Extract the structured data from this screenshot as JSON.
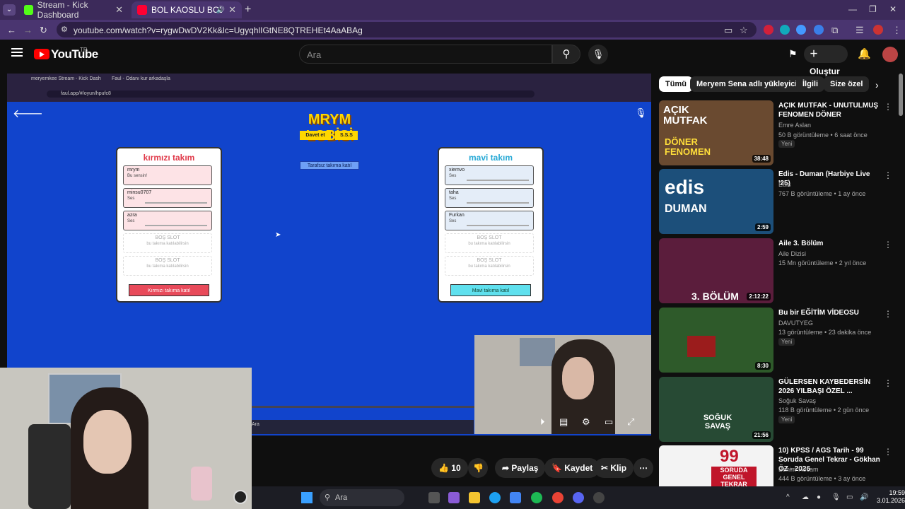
{
  "browser": {
    "tabs": [
      {
        "title": "Stream - Kick Dashboard",
        "favicon_color": "#53fc18"
      },
      {
        "title": "BOL KAOSLU BOL KAVGALI",
        "favicon_color": "#ff0033"
      }
    ],
    "url": "youtube.com/watch?v=rygwDwDV2Kk&lc=UgyqhlIGtNE8QTREHEt4AaABAg"
  },
  "youtube": {
    "logo_text": "YouTube",
    "logo_region": "TR",
    "search_placeholder": "Ara",
    "create_label": "Oluştur"
  },
  "game": {
    "inner_tabs": [
      "meryemkee Stream - Kick Dash",
      "Faul - Odanı kur arkadaşla"
    ],
    "inner_url": "faul.app/#/oyun/hpufc8",
    "lobby_title": "MRYM LOBİSİ",
    "invite_label": "Davet et",
    "faq_label": "S.S.S",
    "neutral_join_label": "Tarafsız takıma katıl",
    "red_team": {
      "title": "kırmızı takım",
      "slots": [
        {
          "name": "mrym",
          "sub": "Bu sensin!"
        },
        {
          "name": "minsu0707",
          "sub": "Ses"
        },
        {
          "name": "azra",
          "sub": "Ses"
        },
        {
          "name": "BOŞ SLOT",
          "sub": "bu takıma katılabilirsin"
        },
        {
          "name": "BOŞ SLOT",
          "sub": "bu takıma katılabilirsin"
        }
      ],
      "join_label": "Kırmızı takıma katıl"
    },
    "blue_team": {
      "title": "mavi takım",
      "slots": [
        {
          "name": "xiemvo",
          "sub": "Ses"
        },
        {
          "name": "taha",
          "sub": "Ses"
        },
        {
          "name": "Furkan",
          "sub": "Ses"
        },
        {
          "name": "BOŞ SLOT",
          "sub": "bu takıma katılabilirsin"
        },
        {
          "name": "BOŞ SLOT",
          "sub": "bu takıma katılabilirsin"
        }
      ],
      "join_label": "Mavi takıma katıl"
    },
    "inner_taskbar_search": "Ara"
  },
  "actions": {
    "likes": "10",
    "share": "Paylaş",
    "save": "Kaydet",
    "clip": "Klip"
  },
  "chips": [
    "Tümü",
    "Meryem Sena adlı yükleyiciden",
    "İlgili",
    "Size özel"
  ],
  "videos": [
    {
      "title": "AÇIK MUTFAK - UNUTULMUŞ FENOMEN DÖNER",
      "channel": "Emre Aslan",
      "meta": "50 B görüntüleme • 6 saat önce",
      "badge": "Yeni",
      "duration": "38:48",
      "thumb_text": "AÇIK MUTFAK",
      "thumb_text2": "DÖNER FENOMEN"
    },
    {
      "title": "Edis - Duman (Harbiye Live '25)",
      "channel": "Edis",
      "meta": "767 B görüntüleme • 1 ay önce",
      "badge": "",
      "duration": "2:59",
      "thumb_text": "edis",
      "thumb_text2": "DUMAN"
    },
    {
      "title": "Aile 3. Bölüm",
      "channel": "Aile Dizisi",
      "meta": "15 Mn görüntüleme • 2 yıl önce",
      "badge": "",
      "duration": "2:12:22",
      "thumb_text": "3. BÖLÜM",
      "thumb_text2": ""
    },
    {
      "title": "Bu bir EĞİTİM VİDEOSU",
      "channel": "DAVUTYEG",
      "meta": "13 görüntüleme • 23 dakika önce",
      "badge": "Yeni",
      "duration": "8:30",
      "thumb_text": "",
      "thumb_text2": ""
    },
    {
      "title": "GÜLERSEN KAYBEDERSİN 2026 YILBAŞI ÖZEL ...",
      "channel": "Soğuk Savaş",
      "meta": "118 B görüntüleme • 2 gün önce",
      "badge": "Yeni",
      "duration": "21:56",
      "thumb_text": "SOĞUK SAVAŞ",
      "thumb_text2": ""
    },
    {
      "title": "10) KPSS / AGS Tarih - 99 Soruda Genel Tekrar - Gökhan ÖZ - 2026",
      "channel": "Benim Hocam",
      "meta": "444 B görüntüleme • 3 ay önce",
      "badge": "",
      "duration": "",
      "thumb_text": "99",
      "thumb_text2": "SORUDA GENEL TEKRAR"
    }
  ],
  "taskbar": {
    "search": "Ara",
    "time": "19:59",
    "date": "3.01.2026"
  }
}
